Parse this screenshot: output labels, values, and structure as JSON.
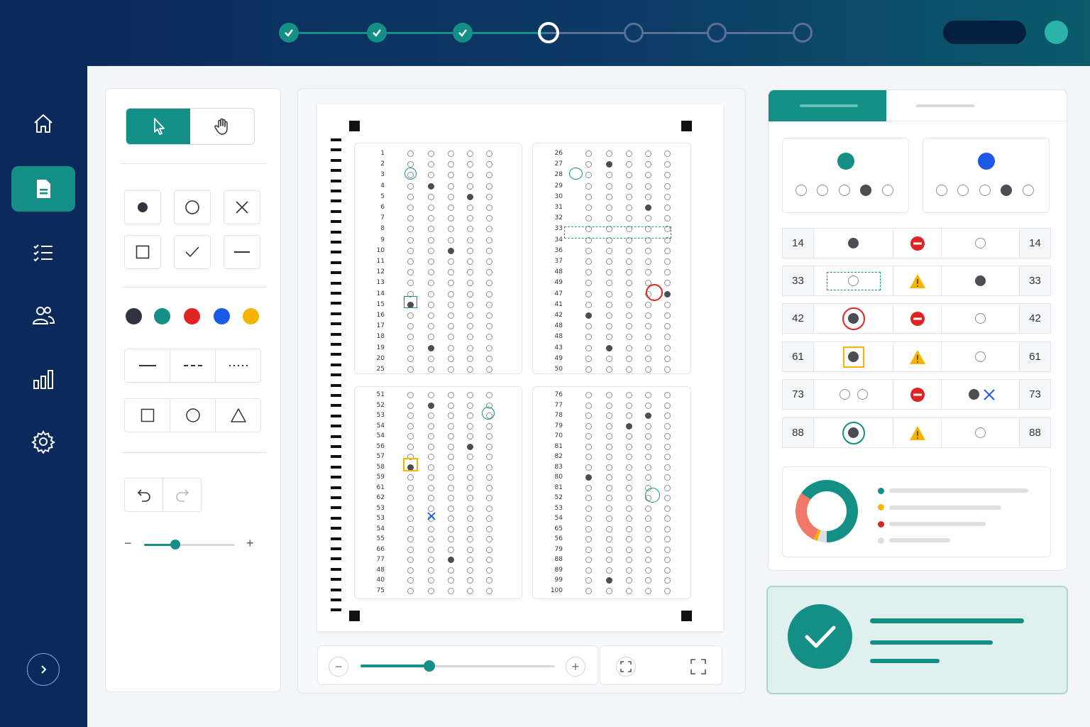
{
  "colors": {
    "sidebar": "#0b2a5b",
    "accent": "#148f86",
    "error": "#e02424",
    "warning": "#f5b400",
    "palette": [
      "#2f3440",
      "#148f86",
      "#e02424",
      "#1a5ae6",
      "#f5b400"
    ]
  },
  "sidebar": {
    "items": [
      {
        "name": "home",
        "icon": "home-icon",
        "active": false
      },
      {
        "name": "document",
        "icon": "document-icon",
        "active": true
      },
      {
        "name": "checklist",
        "icon": "checklist-icon",
        "active": false
      },
      {
        "name": "users",
        "icon": "users-icon",
        "active": false
      },
      {
        "name": "analytics",
        "icon": "bar-chart-icon",
        "active": false
      },
      {
        "name": "settings",
        "icon": "gear-icon",
        "active": false
      }
    ],
    "expand_icon": "chevron-right-icon"
  },
  "stepper": {
    "steps": [
      "done",
      "done",
      "done",
      "current",
      "todo",
      "todo",
      "todo"
    ]
  },
  "tools": {
    "modes": [
      "select-cursor-icon",
      "hand-pan-icon"
    ],
    "active_mode": "select-cursor-icon",
    "mark_types": [
      "filled-dot-icon",
      "empty-circle-icon",
      "cross-icon",
      "square-icon",
      "check-icon",
      "dash-icon"
    ],
    "line_styles": [
      "solid-line-icon",
      "dashed-line-icon",
      "dotted-line-icon"
    ],
    "shapes": [
      "square-shape-icon",
      "circle-shape-icon",
      "triangle-shape-icon"
    ],
    "history": [
      "undo-icon",
      "redo-icon"
    ],
    "size_slider": {
      "minus": "−",
      "plus": "+",
      "value": 0.33
    }
  },
  "sheet": {
    "block1": {
      "questions": [
        "1",
        "2",
        "3",
        "4",
        "5",
        "6",
        "7",
        "8",
        "9",
        "10",
        "11",
        "12",
        "13",
        "14",
        "15",
        "16",
        "17",
        "18",
        "19",
        "20",
        "25"
      ],
      "filled": {
        "4": 1,
        "5": 3,
        "10": 2,
        "15": 0,
        "19": 1
      }
    },
    "block2": {
      "questions": [
        "26",
        "27",
        "28",
        "29",
        "30",
        "31",
        "32",
        "33",
        "34",
        "36",
        "37",
        "48",
        "49",
        "47",
        "41",
        "42",
        "48",
        "48",
        "43",
        "49",
        "50"
      ],
      "filled": {
        "27": 1,
        "31": 3,
        "47": 4,
        "42": 0,
        "43": 1
      }
    },
    "block3": {
      "questions": [
        "51",
        "52",
        "53",
        "54",
        "54",
        "56",
        "57",
        "58",
        "59",
        "61",
        "62",
        "53",
        "53",
        "54",
        "55",
        "66",
        "77",
        "48",
        "40",
        "75"
      ],
      "filled": {
        "52": 1,
        "56": 3,
        "58": 0,
        "77": 2
      }
    },
    "block4": {
      "questions": [
        "76",
        "77",
        "78",
        "79",
        "70",
        "81",
        "82",
        "83",
        "80",
        "81",
        "52",
        "53",
        "54",
        "65",
        "56",
        "79",
        "88",
        "89",
        "99",
        "100"
      ],
      "filled": {
        "78": 3,
        "79": 2,
        "80": 0,
        "99": 1
      }
    }
  },
  "zoom": {
    "minus": "−",
    "plus": "+",
    "value": 0.35,
    "fit_icon": "fit-screen-icon",
    "fullscreen_icon": "fullscreen-icon"
  },
  "review": {
    "answer_key": [
      {
        "color": "#148f86",
        "filled_index": 3
      },
      {
        "color": "#1a5ae6",
        "filled_index": 3
      }
    ],
    "rows": [
      {
        "q": "14",
        "detected": "filled-dot",
        "status": "error-icon",
        "expected": "empty-circle",
        "q2": "14"
      },
      {
        "q": "33",
        "detected": "dashed-selection",
        "status": "warning-icon",
        "expected": "filled-dot",
        "q2": "33"
      },
      {
        "q": "42",
        "detected": "red-circled-dot",
        "status": "error-icon",
        "expected": "empty-circle",
        "q2": "42"
      },
      {
        "q": "61",
        "detected": "yellow-boxed-dot",
        "status": "warning-icon",
        "expected": "empty-circle",
        "q2": "61"
      },
      {
        "q": "73",
        "detected": "two-empty-circles",
        "status": "error-icon",
        "expected": "filled-dot-with-cross",
        "q2": "73"
      },
      {
        "q": "88",
        "detected": "teal-circled-dot",
        "status": "warning-icon",
        "expected": "empty-circle",
        "q2": "88"
      }
    ]
  },
  "chart_data": {
    "type": "pie",
    "series": [
      {
        "values": [
          65,
          28,
          2,
          5
        ],
        "colors": [
          "#148f86",
          "#f07869",
          "#f5b400",
          "#dcdfe3"
        ]
      }
    ]
  },
  "status": {
    "icon": "check-circle-icon"
  }
}
